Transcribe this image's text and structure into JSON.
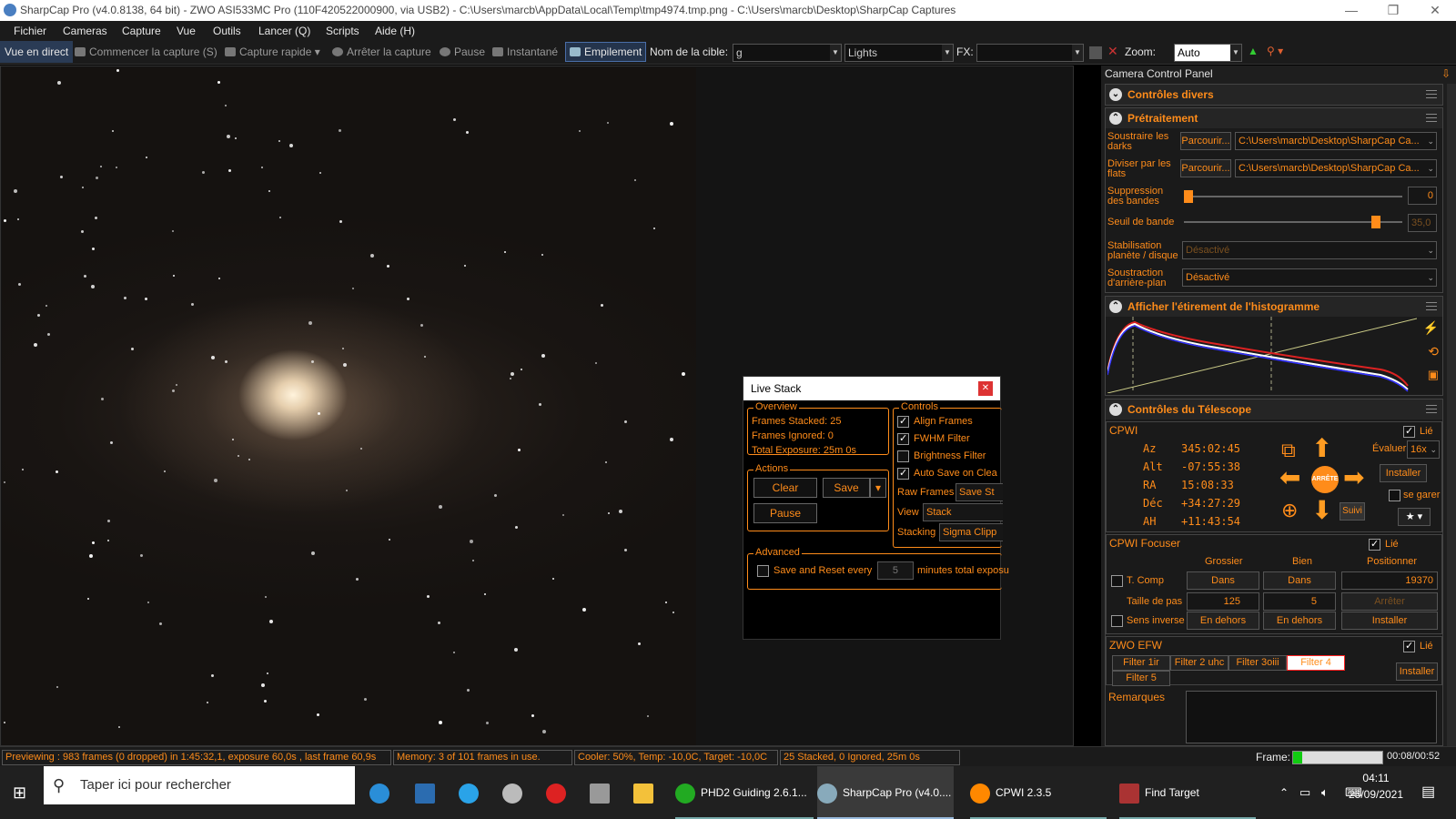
{
  "window": {
    "title": "SharpCap Pro (v4.0.8138, 64 bit) - ZWO ASI533MC Pro (110F420522000900, via USB2) - C:\\Users\\marcb\\AppData\\Local\\Temp\\tmp4974.tmp.png - C:\\Users\\marcb\\Desktop\\SharpCap Captures"
  },
  "menu": [
    "Fichier",
    "Cameras",
    "Capture",
    "Vue",
    "Outils",
    "Lancer (Q)",
    "Scripts",
    "Aide (H)"
  ],
  "toolbar": {
    "live_view": "Vue en direct",
    "start_capture": "Commencer la capture (S)",
    "quick_capture": "Capture rapide",
    "stop_capture": "Arrêter la capture",
    "pause": "Pause",
    "snapshot": "Instantané",
    "stacking": "Empilement",
    "target_label": "Nom de la cible:",
    "target_value": "g",
    "frame_type": "Lights",
    "fx_label": "FX:",
    "fx_value": "",
    "zoom_label": "Zoom:",
    "zoom_value": "Auto"
  },
  "panel": {
    "title": "Camera Control Panel",
    "misc": {
      "title": "Contrôles divers"
    },
    "preprocess": {
      "title": "Prétraitement",
      "darks_label": "Soustraire les darks",
      "darks_browse": "Parcourir...",
      "darks_path": "C:\\Users\\marcb\\Desktop\\SharpCap Ca...",
      "flats_label": "Diviser par les flats",
      "flats_browse": "Parcourir...",
      "flats_path": "C:\\Users\\marcb\\Desktop\\SharpCap Ca...",
      "banding_label": "Suppression des bandes",
      "banding_value": "0",
      "threshold_label": "Seuil de bande",
      "threshold_value": "35,0",
      "stabilize_label": "Stabilisation planète / disque",
      "stabilize_value": "Désactivé",
      "bgsub_label": "Soustraction d'arrière-plan",
      "bgsub_value": "Désactivé"
    },
    "histogram": {
      "title": "Afficher l'étirement de l'histogramme"
    },
    "telescope": {
      "title": "Contrôles du Télescope",
      "mount": "CPWI",
      "linked": "Lié",
      "az_label": "Az",
      "az": "345:02:45",
      "alt_label": "Alt",
      "alt": "-07:55:38",
      "ra_label": "RA",
      "ra": "15:08:33",
      "dec_label": "Déc",
      "dec": "+34:27:29",
      "ha_label": "AH",
      "ha": "+11:43:54",
      "stop": "ARRÊTE",
      "track": "Suivi",
      "rate_label": "Évaluer:",
      "rate_value": "16x",
      "setup": "Installer",
      "park": "se garer"
    },
    "focuser": {
      "name": "CPWI Focuser",
      "linked": "Lié",
      "coarse": "Grossier",
      "fine": "Bien",
      "position": "Positionner",
      "tcomp": "T. Comp",
      "in_coarse": "Dans",
      "in_fine": "Dans",
      "position_value": "19370",
      "step_label": "Taille de pas",
      "step_coarse": "125",
      "step_fine": "5",
      "stop": "Arrêter",
      "reverse": "Sens inverse",
      "out_coarse": "En dehors",
      "out_fine": "En dehors",
      "setup": "Installer"
    },
    "efw": {
      "name": "ZWO EFW",
      "linked": "Lié",
      "filters": [
        "Filter 1ir",
        "Filter 2 uhc",
        "Filter 3oiii",
        "Filter 4",
        "Filter 5"
      ],
      "setup": "Installer"
    },
    "notes_label": "Remarques"
  },
  "livestack": {
    "title": "Live Stack",
    "overview": "Overview",
    "stacked": "Frames Stacked: 25",
    "ignored": "Frames Ignored:  0",
    "exposure": "Total Exposure:   25m 0s",
    "actions": "Actions",
    "clear": "Clear",
    "save": "Save",
    "pause": "Pause",
    "controls": "Controls",
    "align": "Align Frames",
    "fwhm": "FWHM Filter",
    "brightness": "Brightness Filter",
    "autosave": "Auto Save on Clea",
    "raw_label": "Raw Frames",
    "raw_value": "Save St",
    "view_label": "View",
    "view_value": "Stack",
    "stacking_label": "Stacking",
    "stacking_value": "Sigma Clipp",
    "advanced": "Advanced",
    "save_reset": "Save and Reset every",
    "save_reset_value": "5",
    "save_reset_suffix": "minutes total exposu"
  },
  "status": {
    "preview": "Previewing : 983 frames (0 dropped) in 1:45:32,1, exposure 60,0s , last frame 60,9s",
    "memory": "Memory: 3 of 101 frames in use.",
    "cooler": "Cooler: 50%, Temp: -10,0C, Target: -10,0C",
    "stacked": "25 Stacked, 0 Ignored, 25m 0s",
    "frame_label": "Frame:",
    "frame_time": "00:08/00:52",
    "frame_progress": 0.1
  },
  "taskbar": {
    "search": "Taper ici pour rechercher",
    "apps": [
      "PHD2 Guiding 2.6.1...",
      "SharpCap Pro (v4.0....",
      "CPWI 2.3.5",
      "Find Target"
    ],
    "time": "04:11",
    "date": "25/09/2021"
  }
}
